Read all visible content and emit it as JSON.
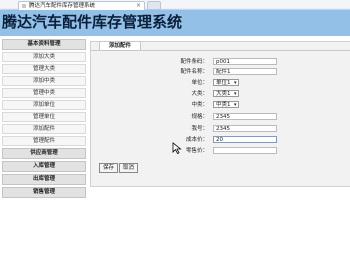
{
  "browser": {
    "tab_title": "腾达汽车配件库存管理系统",
    "close_glyph": "×"
  },
  "header": {
    "title": "腾达汽车配件库存管理系统"
  },
  "sidebar": {
    "section_basic": "基本资料管理",
    "items": [
      "添加大类",
      "管理大类",
      "添加中类",
      "管理中类",
      "添加单位",
      "管理单位",
      "添加配件",
      "管理配件"
    ],
    "sections": [
      "供应商管理",
      "入库管理",
      "出库管理",
      "销售管理"
    ]
  },
  "form": {
    "tab_label": "添加配件",
    "fields": {
      "code": {
        "label": "配件条码：",
        "value": "p001"
      },
      "name": {
        "label": "配件名称：",
        "value": "配件1"
      },
      "unit": {
        "label": "单位：",
        "value": "单位1"
      },
      "major": {
        "label": "大类：",
        "value": "大类1"
      },
      "minor": {
        "label": "中类：",
        "value": "中类1"
      },
      "spec": {
        "label": "规格：",
        "value": "2345"
      },
      "model": {
        "label": "我号：",
        "value": "2345"
      },
      "cost": {
        "label": "成本价：",
        "value": "20"
      },
      "retail": {
        "label": "零售价：",
        "value": ""
      }
    },
    "save_label": "保存",
    "cancel_label": "取消"
  },
  "icons": {
    "dropdown_arrow": "▾"
  }
}
